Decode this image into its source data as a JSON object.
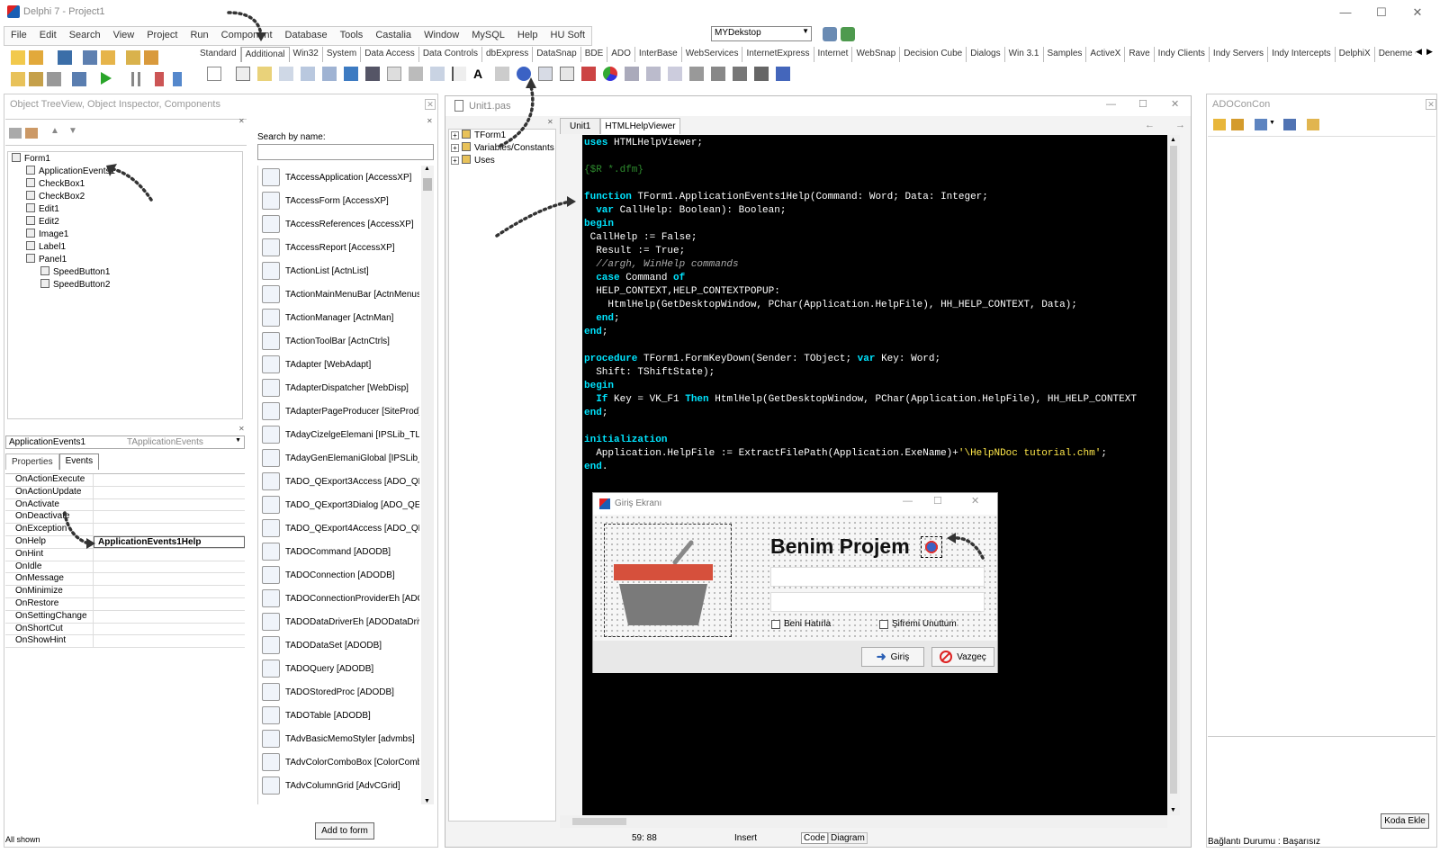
{
  "window": {
    "title": "Delphi 7 - Project1"
  },
  "menu": [
    "File",
    "Edit",
    "Search",
    "View",
    "Project",
    "Run",
    "Component",
    "Database",
    "Tools",
    "Castalia",
    "Window",
    "MySQL",
    "Help",
    "HU Soft"
  ],
  "desktop_select": "MYDekstop",
  "palette_tabs": [
    "Standard",
    "Additional",
    "Win32",
    "System",
    "Data Access",
    "Data Controls",
    "dbExpress",
    "DataSnap",
    "BDE",
    "ADO",
    "InterBase",
    "WebServices",
    "InternetExpress",
    "Internet",
    "WebSnap",
    "Decision Cube",
    "Dialogs",
    "Win 3.1",
    "Samples",
    "ActiveX",
    "Rave",
    "Indy Clients",
    "Indy Servers",
    "Indy Intercepts",
    "DelphiX",
    "Deneme Co"
  ],
  "left_panel": {
    "title": "Object TreeView, Object Inspector, Components"
  },
  "tree": [
    {
      "label": "Form1",
      "indent": 0
    },
    {
      "label": "ApplicationEvents1",
      "indent": 1
    },
    {
      "label": "CheckBox1",
      "indent": 1
    },
    {
      "label": "CheckBox2",
      "indent": 1
    },
    {
      "label": "Edit1",
      "indent": 1
    },
    {
      "label": "Edit2",
      "indent": 1
    },
    {
      "label": "Image1",
      "indent": 1
    },
    {
      "label": "Label1",
      "indent": 1
    },
    {
      "label": "Panel1",
      "indent": 1
    },
    {
      "label": "SpeedButton1",
      "indent": 2
    },
    {
      "label": "SpeedButton2",
      "indent": 2
    }
  ],
  "inspector": {
    "object_name": "ApplicationEvents1",
    "object_type": "TApplicationEvents",
    "tabs": [
      "Properties",
      "Events"
    ],
    "events": [
      {
        "name": "OnActionExecute",
        "value": ""
      },
      {
        "name": "OnActionUpdate",
        "value": ""
      },
      {
        "name": "OnActivate",
        "value": ""
      },
      {
        "name": "OnDeactivate",
        "value": ""
      },
      {
        "name": "OnException",
        "value": ""
      },
      {
        "name": "OnHelp",
        "value": "ApplicationEvents1Help"
      },
      {
        "name": "OnHint",
        "value": ""
      },
      {
        "name": "OnIdle",
        "value": ""
      },
      {
        "name": "OnMessage",
        "value": ""
      },
      {
        "name": "OnMinimize",
        "value": ""
      },
      {
        "name": "OnRestore",
        "value": ""
      },
      {
        "name": "OnSettingChange",
        "value": ""
      },
      {
        "name": "OnShortCut",
        "value": ""
      },
      {
        "name": "OnShowHint",
        "value": ""
      }
    ],
    "status": "All shown"
  },
  "components": {
    "search_label": "Search by name:",
    "items": [
      "TAccessApplication [AccessXP]",
      "TAccessForm [AccessXP]",
      "TAccessReferences [AccessXP]",
      "TAccessReport [AccessXP]",
      "TActionList [ActnList]",
      "TActionMainMenuBar [ActnMenus]",
      "TActionManager [ActnMan]",
      "TActionToolBar [ActnCtrls]",
      "TAdapter [WebAdapt]",
      "TAdapterDispatcher [WebDisp]",
      "TAdapterPageProducer [SiteProd]",
      "TAdayCizelgeElemani [IPSLib_TLB]",
      "TAdayGenElemaniGlobal [IPSLib_TL",
      "TADO_QExport3Access [ADO_QEx",
      "TADO_QExport3Dialog [ADO_QExp",
      "TADO_QExport4Access [ADO_QEx",
      "TADOCommand [ADODB]",
      "TADOConnection [ADODB]",
      "TADOConnectionProviderEh [ADOD",
      "TADODataDriverEh [ADODataDrive",
      "TADODataSet [ADODB]",
      "TADOQuery [ADODB]",
      "TADOStoredProc [ADODB]",
      "TADOTable [ADODB]",
      "TAdvBasicMemoStyler [advmbs]",
      "TAdvColorComboBox [ColorCombo]",
      "TAdvColumnGrid [AdvCGrid]"
    ],
    "add_button": "Add to form"
  },
  "editor": {
    "title": "Unit1.pas",
    "tabs": [
      "Unit1",
      "HTMLHelpViewer"
    ],
    "explorer": [
      "TForm1",
      "Variables/Constants",
      "Uses"
    ],
    "status": {
      "pos": "59: 88",
      "mode": "Insert",
      "tabs": [
        "Code",
        "Diagram"
      ]
    }
  },
  "code_lines": [
    [
      [
        "kw",
        "uses"
      ],
      [
        "idn",
        " HTMLHelpViewer;"
      ]
    ],
    [],
    [
      [
        "dr",
        "{$R *.dfm}"
      ]
    ],
    [],
    [
      [
        "kw",
        "function"
      ],
      [
        "idn",
        " TForm1.ApplicationEvents1Help(Command: Word; Data: Integer;"
      ]
    ],
    [
      [
        "idn",
        "  "
      ],
      [
        "kw",
        "var"
      ],
      [
        "idn",
        " CallHelp: Boolean): Boolean;"
      ]
    ],
    [
      [
        "kw",
        "begin"
      ]
    ],
    [
      [
        "idn",
        " CallHelp := False;"
      ]
    ],
    [
      [
        "idn",
        "  Result := True;"
      ]
    ],
    [
      [
        "cm",
        "  //argh, WinHelp commands"
      ]
    ],
    [
      [
        "idn",
        "  "
      ],
      [
        "kw",
        "case"
      ],
      [
        "idn",
        " Command "
      ],
      [
        "kw",
        "of"
      ]
    ],
    [
      [
        "idn",
        "  HELP_CONTEXT,HELP_CONTEXTPOPUP:"
      ]
    ],
    [
      [
        "idn",
        "    HtmlHelp(GetDesktopWindow, PChar(Application.HelpFile), HH_HELP_CONTEXT, Data);"
      ]
    ],
    [
      [
        "idn",
        "  "
      ],
      [
        "kw",
        "end"
      ],
      [
        "idn",
        ";"
      ]
    ],
    [
      [
        "kw",
        "end"
      ],
      [
        "idn",
        ";"
      ]
    ],
    [],
    [
      [
        "kw",
        "procedure"
      ],
      [
        "idn",
        " TForm1.FormKeyDown(Sender: TObject; "
      ],
      [
        "kw",
        "var"
      ],
      [
        "idn",
        " Key: Word;"
      ]
    ],
    [
      [
        "idn",
        "  Shift: TShiftState);"
      ]
    ],
    [
      [
        "kw",
        "begin"
      ]
    ],
    [
      [
        "idn",
        "  "
      ],
      [
        "kw",
        "If"
      ],
      [
        "idn",
        " Key = VK_F1 "
      ],
      [
        "kw",
        "Then"
      ],
      [
        "idn",
        " HtmlHelp(GetDesktopWindow, PChar(Application.HelpFile), HH_HELP_CONTEXT"
      ]
    ],
    [
      [
        "kw",
        "end"
      ],
      [
        "idn",
        ";"
      ]
    ],
    [],
    [
      [
        "kw",
        "initialization"
      ]
    ],
    [
      [
        "idn",
        "  Application.HelpFile := ExtractFilePath(Application.ExeName)+"
      ],
      [
        "str",
        "'\\HelpNDoc tutorial.chm'"
      ],
      [
        "idn",
        ";"
      ]
    ],
    [
      [
        "kw",
        "end"
      ],
      [
        "idn",
        "."
      ]
    ]
  ],
  "form": {
    "title": "Giriş Ekranı",
    "heading": "Benim Projem",
    "checkbox1": "Beni Hatırla",
    "checkbox2": "Şifremi Unuttum",
    "btn_ok": "Giriş",
    "btn_cancel": "Vazgeç"
  },
  "right_panel": {
    "title": "ADOConCon",
    "button": "Koda Ekle",
    "status": "Bağlantı Durumu : Başarısız"
  }
}
